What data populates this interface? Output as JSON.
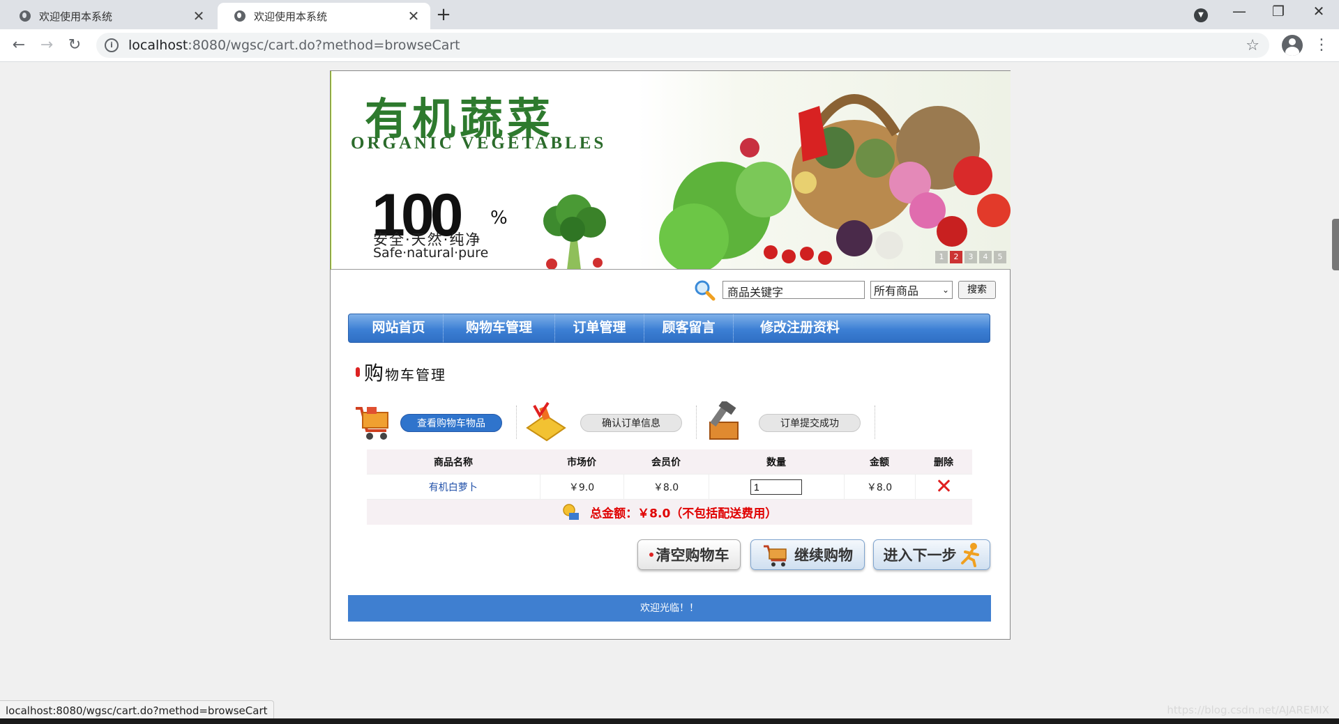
{
  "browser": {
    "tabs": [
      {
        "title": "欢迎使用本系统",
        "active": false
      },
      {
        "title": "欢迎使用本系统",
        "active": true
      }
    ],
    "url_host": "localhost",
    "url_rest": ":8080/wgsc/cart.do?method=browseCart",
    "status_url": "localhost:8080/wgsc/cart.do?method=browseCart"
  },
  "banner": {
    "logo_cn": "有机蔬菜",
    "logo_en": "ORGANIC VEGETABLES",
    "badge_number": "100",
    "badge_percent": "%",
    "badge_cn": "安全·天然·纯净",
    "badge_en": "Safe·natural·pure",
    "slider": [
      "1",
      "2",
      "3",
      "4",
      "5"
    ]
  },
  "search": {
    "keyword": "商品关键字",
    "category": "所有商品",
    "button": "搜索"
  },
  "nav": [
    {
      "label": "网站首页",
      "w": 128
    },
    {
      "label": "购物车管理",
      "w": 160
    },
    {
      "label": "订单管理",
      "w": 128
    },
    {
      "label": "顾客留言",
      "w": 128
    },
    {
      "label": "修改注册资料",
      "w": 190
    }
  ],
  "section": {
    "title_first": "购",
    "title_rest": "物车管理"
  },
  "steps": [
    {
      "label": "查看购物车物品",
      "current": true
    },
    {
      "label": "确认订单信息",
      "current": false
    },
    {
      "label": "订单提交成功",
      "current": false
    }
  ],
  "table": {
    "headers": [
      "商品名称",
      "市场价",
      "会员价",
      "数量",
      "金额",
      "删除"
    ],
    "rows": [
      {
        "name": "有机白萝卜",
        "market_price": "￥9.0",
        "member_price": "￥8.0",
        "qty": "1",
        "amount": "￥8.0"
      }
    ],
    "total": "总金额：￥8.0（不包括配送费用）"
  },
  "buttons": {
    "clear": "清空购物车",
    "continue": "继续购物",
    "next": "进入下一步"
  },
  "footer": "欢迎光临！！",
  "watermark": "https://blog.csdn.net/AJAREMIX",
  "colors": {
    "nav_blue": "#3c7fd4",
    "total_red": "#e00000",
    "footer_blue": "#3f7fd0"
  }
}
